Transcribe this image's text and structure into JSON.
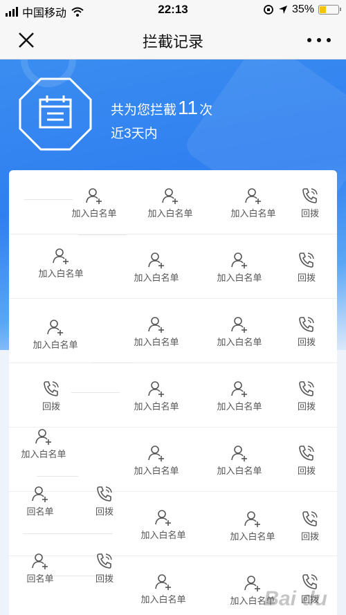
{
  "status_bar": {
    "carrier": "中国移动",
    "time": "22:13",
    "battery": "35%",
    "battery_level": 0.35
  },
  "nav": {
    "title": "拦截记录",
    "close_icon": "close-icon",
    "more_icon": "more-icon"
  },
  "summary": {
    "prefix": "共为您拦截",
    "count": "11",
    "suffix": "次",
    "range": "近3天内"
  },
  "actions": {
    "whitelist": "加入白名单",
    "whitelist_partial": "回名单",
    "callback": "回拨"
  },
  "watermark": "Bai du",
  "colors": {
    "accent": "#2f7ff0",
    "icon_gray": "#555555"
  }
}
